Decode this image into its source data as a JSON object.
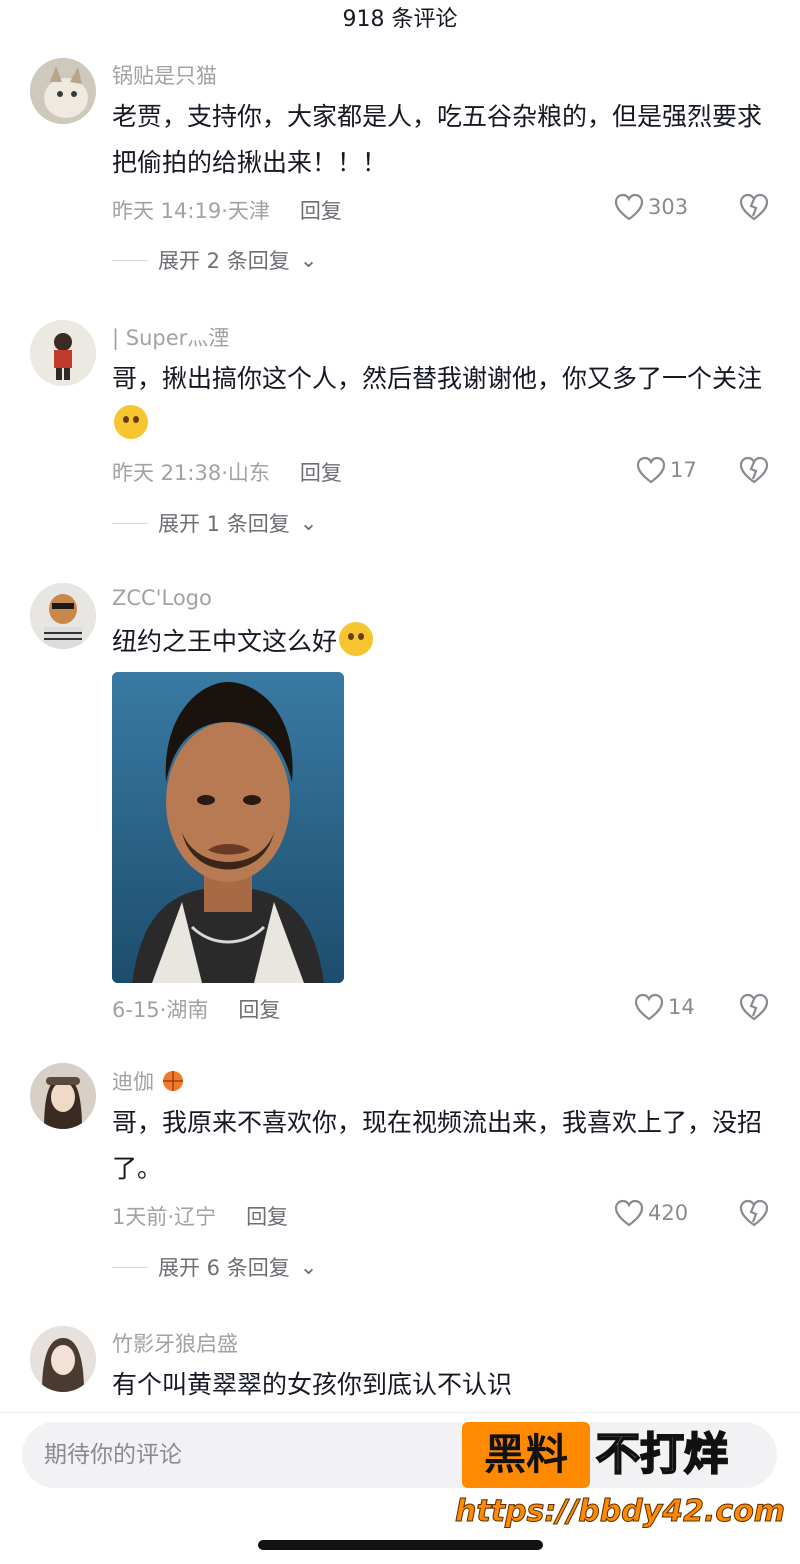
{
  "header": {
    "title": "918 条评论"
  },
  "comments": [
    {
      "username": "锅贴是只猫",
      "text": "老贾，支持你，大家都是人，吃五谷杂粮的，但是强烈要求把偷拍的给揪出来！！！",
      "time": "昨天 14:19",
      "location": "天津",
      "reply_label": "回复",
      "likes": "303",
      "expand_label": "展开 2 条回复"
    },
    {
      "username": "| Super灬湮",
      "text": "哥，揪出搞你这个人，然后替我谢谢他，你又多了一个关注",
      "time": "昨天 21:38",
      "location": "山东",
      "reply_label": "回复",
      "likes": "17",
      "expand_label": "展开 1 条回复"
    },
    {
      "username": "ZCC'Logo",
      "text": "纽约之王中文这么好",
      "time": "6-15",
      "location": "湖南",
      "reply_label": "回复",
      "likes": "14"
    },
    {
      "username": "迪伽",
      "text": "哥，我原来不喜欢你，现在视频流出来，我喜欢上了，没招了。",
      "time": "1天前",
      "location": "辽宁",
      "reply_label": "回复",
      "likes": "420",
      "expand_label": "展开 6 条回复"
    },
    {
      "username": "竹影牙狼启盛",
      "text": "有个叫黄翠翠的女孩你到底认不认识"
    }
  ],
  "input": {
    "placeholder": "期待你的评论"
  },
  "watermark": {
    "black_text": "黑料",
    "white_text": "不打烊",
    "url": "https://bbdy42.com"
  },
  "colors": {
    "accent_orange": "#ff8a00",
    "meta_gray": "#a1a2a6",
    "text": "#161823"
  }
}
